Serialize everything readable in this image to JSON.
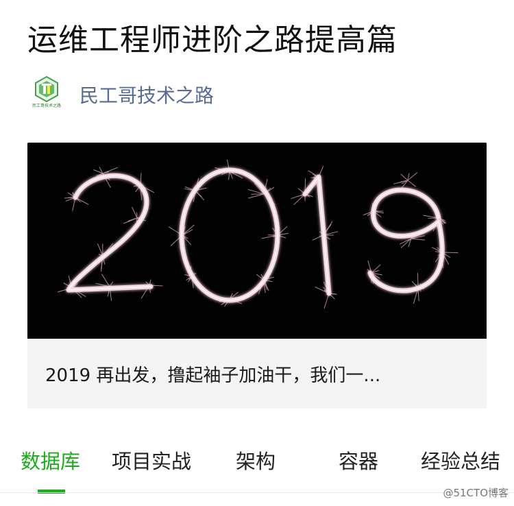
{
  "article": {
    "title": "运维工程师进阶之路提高篇"
  },
  "account": {
    "name": "民工哥技术之路",
    "logo_text": "民工哥技术之路",
    "logo_icon": "account-logo-icon"
  },
  "card": {
    "image_text": "2019",
    "caption": "2019 再出发，撸起袖子加油干，我们一..."
  },
  "tabs": [
    {
      "label": "数据库",
      "active": true
    },
    {
      "label": "项目实战",
      "active": false
    },
    {
      "label": "架构",
      "active": false
    },
    {
      "label": "容器",
      "active": false
    },
    {
      "label": "经验总结",
      "active": false
    }
  ],
  "watermark": "@51CTO博客",
  "colors": {
    "accent": "#1aad19",
    "link": "#576b95",
    "sparkler": "#f3c9d8"
  }
}
